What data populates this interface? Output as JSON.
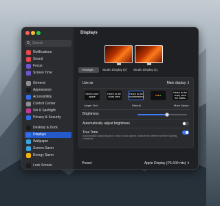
{
  "sidebar": {
    "search_placeholder": "Search",
    "items": [
      {
        "label": "Notifications",
        "color": "#e5484d"
      },
      {
        "label": "Sound",
        "color": "#e5484d"
      },
      {
        "label": "Focus",
        "color": "#6e56cf"
      },
      {
        "label": "Screen Time",
        "color": "#6e56cf"
      },
      {
        "label": "General",
        "color": "#8e8e93"
      },
      {
        "label": "Appearance",
        "color": "#1c1c1e"
      },
      {
        "label": "Accessibility",
        "color": "#2f6fe8"
      },
      {
        "label": "Control Center",
        "color": "#8e8e93"
      },
      {
        "label": "Siri & Spotlight",
        "color": "#c2399a"
      },
      {
        "label": "Privacy & Security",
        "color": "#2f6fe8"
      },
      {
        "label": "Desktop & Dock",
        "color": "#1c1c1e"
      },
      {
        "label": "Displays",
        "color": "#2f6fe8"
      },
      {
        "label": "Wallpaper",
        "color": "#38a3e0"
      },
      {
        "label": "Screen Saver",
        "color": "#38a3e0"
      },
      {
        "label": "Energy Saver",
        "color": "#f5b400"
      },
      {
        "label": "Lock Screen",
        "color": "#1c1c1e"
      }
    ],
    "selected": "Displays"
  },
  "main": {
    "title": "Displays",
    "arrange_label": "Arrange...",
    "displays": [
      {
        "label": "Studio Display (2)",
        "selected": false
      },
      {
        "label": "Studio Display (1)",
        "selected": true
      }
    ],
    "use_as": {
      "label": "Use as",
      "value": "Main display"
    },
    "resolutions": [
      {
        "preview": "Here's more space",
        "label": "Larger Text"
      },
      {
        "preview": "Here's to the crazy ones",
        "label": ""
      },
      {
        "preview": "Here's to the troublemakers",
        "label": "Default",
        "selected": true
      },
      {
        "preview": "",
        "label": ""
      },
      {
        "preview": "Here's to the crazy ones the misfits",
        "label": "More Space"
      }
    ],
    "brightness": {
      "label": "Brightness",
      "value": 0.6
    },
    "auto_brightness": {
      "label": "Automatically adjust brightness",
      "on": false
    },
    "true_tone": {
      "label": "True Tone",
      "description": "Automatically adapt display to make colors appear consistent in different ambient lighting conditions.",
      "on": true
    },
    "preset": {
      "label": "Preset",
      "value": "Apple Display (P3-600 nits)"
    }
  },
  "colors": {
    "accent": "#3d7bfd",
    "selection": "#2459c9"
  }
}
